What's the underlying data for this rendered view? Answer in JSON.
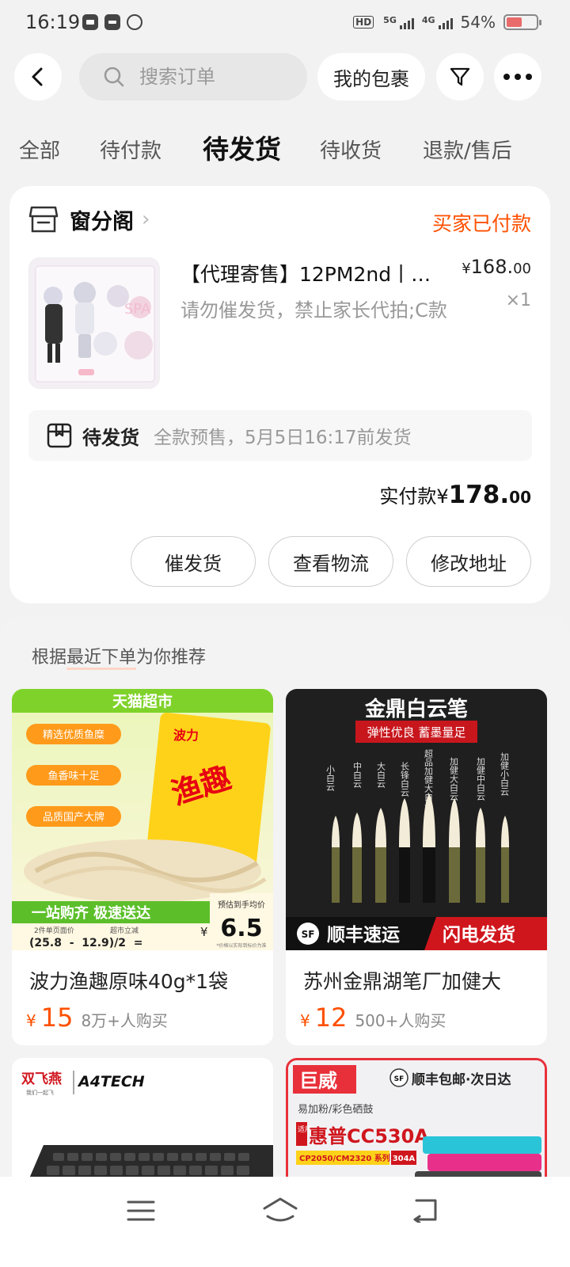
{
  "status_bar": {
    "time": "16:19",
    "hd_label": "HD",
    "net1": "5G",
    "net2": "4G",
    "battery": "54%",
    "battery_level": 0.54
  },
  "header": {
    "back_icon": "chevron-left-icon",
    "search_placeholder": "搜索订单",
    "packages_label": "我的包裹",
    "filter_icon": "filter-icon",
    "more_icon": "more-icon"
  },
  "tabs": [
    {
      "label": "全部",
      "active": false
    },
    {
      "label": "待付款",
      "active": false
    },
    {
      "label": "待发货",
      "active": true
    },
    {
      "label": "待收货",
      "active": false
    },
    {
      "label": "退款/售后",
      "active": false
    }
  ],
  "order": {
    "shop_name": "窗分阁",
    "status": "买家已付款",
    "product_title": "【代理寄售】12PM2nd丨…",
    "product_desc": "请勿催发货，禁止家长代拍;C款",
    "price_currency": "¥",
    "price_int": "168.",
    "price_dec": "00",
    "quantity": "×1",
    "ship_label": "待发货",
    "ship_info": "全款预售，5月5日16:17前发货",
    "paid_label": "实付款",
    "paid_currency": "¥",
    "paid_int": "178.",
    "paid_dec": "00",
    "actions": [
      "催发货",
      "查看物流",
      "修改地址"
    ]
  },
  "recommend": {
    "title_prefix": "根据",
    "title_highlight": "最近下单",
    "title_suffix": "为你推荐",
    "items": [
      {
        "title": "波力渔趣原味40g*1袋",
        "currency": "¥",
        "price": "15",
        "sold": "8万+人购买",
        "img_badge": "天猫超市",
        "img_tags": [
          "精选优质鱼糜",
          "鱼香味十足",
          "品质国产大牌"
        ],
        "img_brand": "波力",
        "img_product": "渔趣",
        "img_slogan": "一站购齐 极速送达",
        "img_est_label": "预估到手均价",
        "img_est_price": "6.5",
        "img_formula_top1": "2件单页面价",
        "img_formula_top2": "超市立减",
        "img_formula": "(25.8  -  12.9)/2  =",
        "img_est_currency": "¥",
        "img_note": "*价格以实际到标价为准"
      },
      {
        "title": "苏州金鼎湖笔厂加健大",
        "currency": "¥",
        "price": "12",
        "sold": "500+人购买",
        "img_title": "金鼎白云笔",
        "img_subtitle": "弹性优良 蓄墨量足",
        "img_brush_names": [
          "小白云",
          "中白云",
          "大白云",
          "长锋白云",
          "超品加健大白云",
          "加健大白云",
          "加健中白云",
          "加健小白云"
        ],
        "img_sf": "SF",
        "img_ship": "顺丰速运",
        "img_fast": "闪电发货"
      },
      {
        "img_brand1": "双飞燕",
        "img_brand1_sub": "我们一起飞",
        "img_brand2": "A4TECH"
      },
      {
        "img_brand": "巨威",
        "img_sf": "SF",
        "img_ship": "顺丰包邮·次日达",
        "img_line1": "易加粉/彩色硒鼓",
        "img_model_prefix": "适用",
        "img_model": "惠普CC530A",
        "img_series": "CP2050/CM2320 系列",
        "img_code": "304A"
      }
    ]
  },
  "nav": {
    "menu_icon": "menu-icon",
    "home_icon": "home-icon",
    "back_icon": "back-icon"
  }
}
